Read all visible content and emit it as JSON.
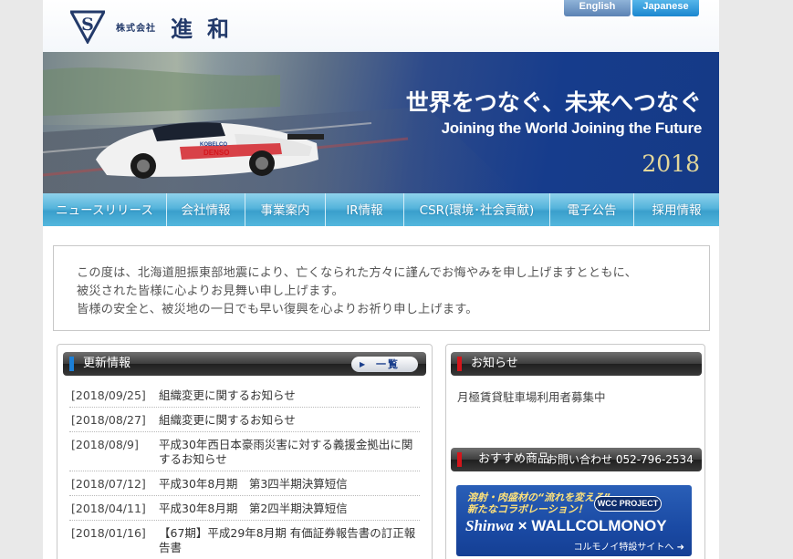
{
  "header": {
    "company_small": "株式会社",
    "company_name": "進和",
    "lang_en": "English",
    "lang_jp": "Japanese"
  },
  "hero": {
    "title_jp": "世界をつなぐ、未来へつなぐ",
    "title_en": "Joining the World Joining the Future",
    "year": "2018"
  },
  "nav": {
    "items": [
      "ニュースリリース",
      "会社情報",
      "事業案内",
      "IR情報",
      "CSR(環境･社会貢献)",
      "電子公告",
      "採用情報"
    ]
  },
  "notice": {
    "lines": [
      "この度は、北海道胆振東部地震により、亡くなられた方々に謹んでお悔やみを申し上げますとともに、",
      "被災された皆様に心よりお見舞い申し上げます。",
      "皆様の安全と、被災地の一日でも早い復興を心よりお祈り申し上げます。"
    ]
  },
  "news": {
    "heading": "更新情報",
    "more_label": "一覧",
    "items": [
      {
        "date": "[2018/09/25]",
        "title": "組織変更に関するお知らせ"
      },
      {
        "date": "[2018/08/27]",
        "title": "組織変更に関するお知らせ"
      },
      {
        "date": "[2018/08/9]",
        "title": "平成30年西日本豪雨災害に対する義援金拠出に関するお知らせ"
      },
      {
        "date": "[2018/07/12]",
        "title": "平成30年8月期　第3四半期決算短信"
      },
      {
        "date": "[2018/04/11]",
        "title": "平成30年8月期　第2四半期決算短信"
      },
      {
        "date": "[2018/01/16]",
        "title": "【67期】平成29年8月期 有価証券報告書の訂正報告書"
      }
    ]
  },
  "oshirase": {
    "heading": "お知らせ",
    "text": "月極賃貸駐車場利用者募集中"
  },
  "recommend": {
    "heading": "おすすめ商品",
    "contact": "お問い合わせ 052-796-2534"
  },
  "banner": {
    "top_line1": "溶射・肉盛材の“流れを変える”",
    "top_line2": "新たなコラボレーション！",
    "pill": "WCC PROJECT",
    "brand_shinwa": "Shinwa",
    "brand_x": "×",
    "brand_wall": "WALLCOLMONOY",
    "link": "コルモノイ特設サイトへ ➜"
  },
  "colors": {
    "nav": "#4fb2da",
    "accent_blue": "#1c7fd6",
    "accent_red": "#d4151b"
  }
}
